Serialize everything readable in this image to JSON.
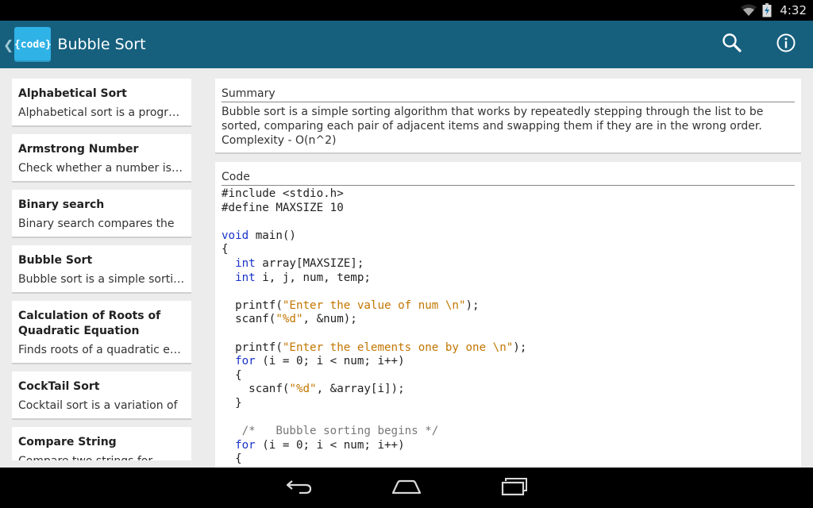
{
  "status_bar": {
    "time": "4:32"
  },
  "action_bar": {
    "up_glyph": "❮",
    "logo_text": "{code}",
    "title": "Bubble Sort",
    "icons": [
      "search-icon",
      "info-icon"
    ]
  },
  "list": {
    "items": [
      {
        "title": "Alphabetical Sort",
        "desc": "Alphabetical sort is a program"
      },
      {
        "title": "Armstrong Number",
        "desc": "Check whether a number is an"
      },
      {
        "title": "Binary search",
        "desc": "Binary search compares the"
      },
      {
        "title": "Bubble Sort",
        "desc": "Bubble sort is a simple sorting"
      },
      {
        "title": "Calculation of Roots of Quadratic Equation",
        "desc": "Finds roots of a quadratic equation"
      },
      {
        "title": "CockTail Sort",
        "desc": "Cocktail sort is a variation of"
      },
      {
        "title": "Compare String",
        "desc": "Compare two strings for"
      }
    ]
  },
  "summary": {
    "header": "Summary",
    "text": "Bubble sort is a simple sorting algorithm that works by repeatedly stepping through the list to be sorted, comparing each pair of adjacent items and swapping them if they are in the wrong order.",
    "complexity": "Complexity - O(n^2)"
  },
  "code": {
    "header": "Code",
    "lines": [
      [
        {
          "t": "#include <stdio.h>",
          "c": "plain"
        }
      ],
      [
        {
          "t": "#define MAXSIZE 10",
          "c": "plain"
        }
      ],
      [
        {
          "t": "",
          "c": "plain"
        }
      ],
      [
        {
          "t": "void",
          "c": "kw"
        },
        {
          "t": " main()",
          "c": "plain"
        }
      ],
      [
        {
          "t": "{",
          "c": "plain"
        }
      ],
      [
        {
          "t": "  ",
          "c": "plain"
        },
        {
          "t": "int",
          "c": "kw"
        },
        {
          "t": " array[MAXSIZE];",
          "c": "plain"
        }
      ],
      [
        {
          "t": "  ",
          "c": "plain"
        },
        {
          "t": "int",
          "c": "kw"
        },
        {
          "t": " i, j, num, temp;",
          "c": "plain"
        }
      ],
      [
        {
          "t": "",
          "c": "plain"
        }
      ],
      [
        {
          "t": "  printf(",
          "c": "plain"
        },
        {
          "t": "\"Enter the value of num \\n\"",
          "c": "str"
        },
        {
          "t": ");",
          "c": "plain"
        }
      ],
      [
        {
          "t": "  scanf(",
          "c": "plain"
        },
        {
          "t": "\"%d\"",
          "c": "str"
        },
        {
          "t": ", &num);",
          "c": "plain"
        }
      ],
      [
        {
          "t": "",
          "c": "plain"
        }
      ],
      [
        {
          "t": "  printf(",
          "c": "plain"
        },
        {
          "t": "\"Enter the elements one by one \\n\"",
          "c": "str"
        },
        {
          "t": ");",
          "c": "plain"
        }
      ],
      [
        {
          "t": "  ",
          "c": "plain"
        },
        {
          "t": "for",
          "c": "kw"
        },
        {
          "t": " (i = 0; i < num; i++)",
          "c": "plain"
        }
      ],
      [
        {
          "t": "  {",
          "c": "plain"
        }
      ],
      [
        {
          "t": "    scanf(",
          "c": "plain"
        },
        {
          "t": "\"%d\"",
          "c": "str"
        },
        {
          "t": ", &array[i]);",
          "c": "plain"
        }
      ],
      [
        {
          "t": "  }",
          "c": "plain"
        }
      ],
      [
        {
          "t": "",
          "c": "plain"
        }
      ],
      [
        {
          "t": "   /*   Bubble sorting begins */",
          "c": "cmt"
        }
      ],
      [
        {
          "t": "  ",
          "c": "plain"
        },
        {
          "t": "for",
          "c": "kw"
        },
        {
          "t": " (i = 0; i < num; i++)",
          "c": "plain"
        }
      ],
      [
        {
          "t": "  {",
          "c": "plain"
        }
      ]
    ]
  },
  "nav_bar": {
    "icons": [
      "back-icon",
      "home-icon",
      "recent-apps-icon"
    ]
  },
  "colors": {
    "action_bar": "#16607e",
    "logo_bg": "#2fb2e6",
    "keyword": "#1a33c9",
    "string": "#c27600",
    "comment": "#777777",
    "content_bg": "#ececec"
  }
}
